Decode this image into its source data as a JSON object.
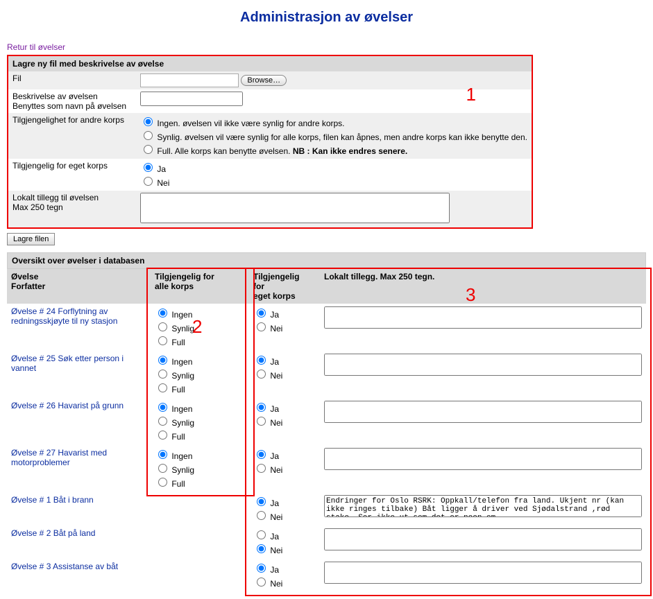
{
  "page_title": "Administrasjon av øvelser",
  "return_link": "Retur til øvelser",
  "upload_section": {
    "header": "Lagre ny fil med beskrivelse av øvelse",
    "file_label": "Fil",
    "browse_button": "Browse…",
    "desc_label_line1": "Beskrivelse av øvelsen",
    "desc_label_line2": "Benyttes som navn på øvelsen",
    "avail_other_label": "Tilgjengelighet for andre korps",
    "avail_other_options": {
      "none": "Ingen. øvelsen vil ikke være synlig for andre korps.",
      "visible": "Synlig. øvelsen vil være synlig for alle korps, filen kan åpnes, men andre korps kan ikke benytte den.",
      "full_prefix": "Full. Alle korps kan benytte øvelsen. ",
      "full_bold": "NB : Kan ikke endres senere."
    },
    "avail_own_label": "Tilgjengelig for eget korps",
    "avail_own_options": {
      "yes": "Ja",
      "no": "Nei"
    },
    "local_label_line1": "Lokalt tillegg til øvelsen",
    "local_label_line2": "Max 250 tegn",
    "save_button": "Lagre filen"
  },
  "annotations": {
    "one": "1",
    "two": "2",
    "three": "3"
  },
  "list_section": {
    "header": "Oversikt over øvelser i databasen",
    "columns": {
      "exercise_line1": "Øvelse",
      "exercise_line2": "Forfatter",
      "all_line1": "Tilgjengelig for",
      "all_line2": "alle korps",
      "own_line1": "Tilgjengelig",
      "own_line2": "for",
      "own_line3": "eget korps",
      "local": "Lokalt tillegg. Max 250 tegn."
    },
    "all_options": {
      "none": "Ingen",
      "visible": "Synlig",
      "full": "Full"
    },
    "own_options": {
      "yes": "Ja",
      "no": "Nei"
    },
    "rows": [
      {
        "title": "Øvelse # 24 Forflytning av redningsskjøyte til ny stasjon",
        "show_all_radios": true,
        "all": "none",
        "own": "yes",
        "text": ""
      },
      {
        "title": "Øvelse # 25 Søk etter person i vannet",
        "show_all_radios": true,
        "all": "none",
        "own": "yes",
        "text": ""
      },
      {
        "title": "Øvelse # 26 Havarist på grunn",
        "show_all_radios": true,
        "all": "none",
        "own": "yes",
        "text": ""
      },
      {
        "title": "Øvelse # 27 Havarist med motorproblemer",
        "show_all_radios": true,
        "all": "none",
        "own": "yes",
        "text": ""
      },
      {
        "title": "Øvelse # 1 Båt i brann",
        "show_all_radios": false,
        "all": "",
        "own": "yes",
        "text": "Endringer for Oslo RSRK: Oppkall/telefon fra land. Ukjent nr (kan ikke ringes tilbake) Båt ligger å driver ved Sjødalstrand ,rød stake. Ser ikke ut som det er noen om"
      },
      {
        "title": "Øvelse # 2 Båt på land",
        "show_all_radios": false,
        "all": "",
        "own": "no",
        "text": ""
      },
      {
        "title": "Øvelse # 3 Assistanse av båt",
        "show_all_radios": false,
        "all": "",
        "own": "yes",
        "text": ""
      }
    ]
  }
}
